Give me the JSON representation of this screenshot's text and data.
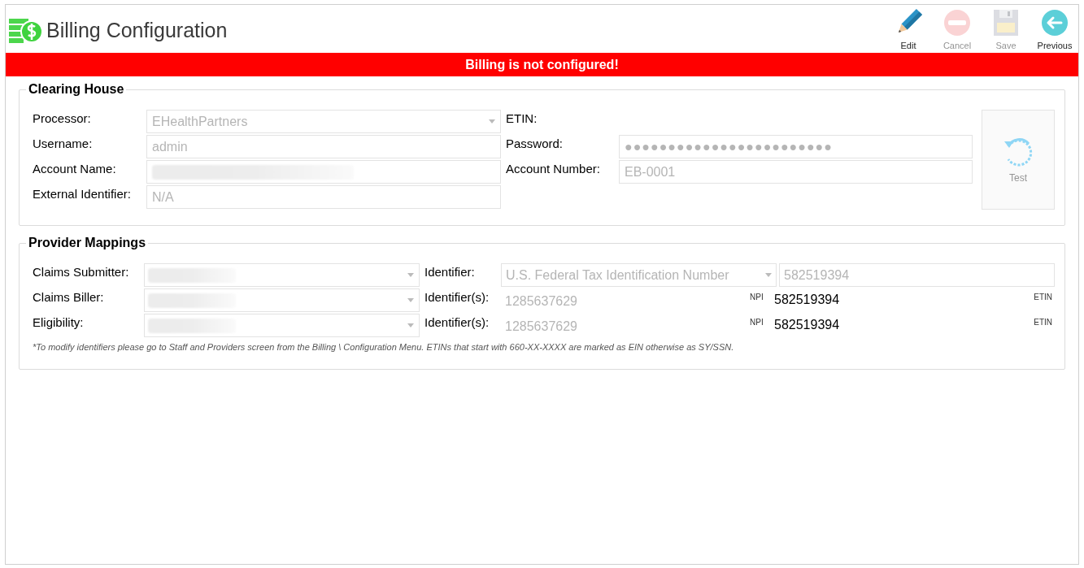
{
  "page": {
    "title": "Billing Configuration"
  },
  "toolbar": [
    {
      "kind": "edit",
      "label": "Edit",
      "disabled": false
    },
    {
      "kind": "cancel",
      "label": "Cancel",
      "disabled": true
    },
    {
      "kind": "save",
      "label": "Save",
      "disabled": true
    },
    {
      "kind": "previous",
      "label": "Previous",
      "disabled": false
    }
  ],
  "alert": "Billing is not configured!",
  "clearing_house": {
    "title": "Clearing House",
    "left_fields": [
      {
        "label": "Processor:",
        "kind": "select",
        "value": "EHealthPartners"
      },
      {
        "label": "Username:",
        "kind": "text",
        "value": "admin"
      },
      {
        "label": "Account Name:",
        "kind": "text",
        "redacted": true
      },
      {
        "label": "External Identifier:",
        "kind": "text",
        "value": "N/A"
      }
    ],
    "right_fields": [
      {
        "label": "ETIN:",
        "kind": "none"
      },
      {
        "label": "Password:",
        "kind": "password",
        "value": "●●●●●●●●●●●●●●●●●●●●●●●●"
      },
      {
        "label": "Account Number:",
        "kind": "text",
        "value": "EB-0001"
      }
    ],
    "test_button": {
      "label": "Test",
      "disabled": true
    }
  },
  "provider_mappings": {
    "title": "Provider Mappings",
    "rows": [
      {
        "label": "Claims Submitter:",
        "redacted": true,
        "id_label": "Identifier:",
        "kind": "select",
        "id_type": "U.S. Federal Tax Identification Number",
        "id_value": "582519394"
      },
      {
        "label": "Claims Biller:",
        "redacted": true,
        "id_label": "Identifier(s):",
        "kind": "pair",
        "npi": "1285637629",
        "npi_tag": "NPI",
        "etin": "582519394",
        "etin_tag": "ETIN"
      },
      {
        "label": "Eligibility:",
        "redacted": true,
        "id_label": "Identifier(s):",
        "kind": "pair",
        "npi": "1285637629",
        "npi_tag": "NPI",
        "etin": "582519394",
        "etin_tag": "ETIN"
      }
    ],
    "note": "*To modify identifiers please go to Staff and Providers screen from the Billing \\ Configuration Menu. ETINs that start with 660-XX-XXXX are marked as EIN otherwise as SY/SSN."
  }
}
